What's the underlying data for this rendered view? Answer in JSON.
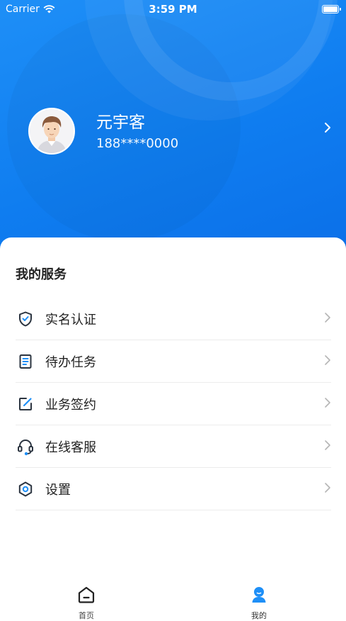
{
  "status_bar": {
    "carrier": "Carrier",
    "time": "3:59 PM"
  },
  "profile": {
    "name": "元宇客",
    "phone": "188****0000"
  },
  "services": {
    "title": "我的服务",
    "items": [
      {
        "label": "实名认证",
        "icon": "shield-check-icon"
      },
      {
        "label": "待办任务",
        "icon": "task-list-icon"
      },
      {
        "label": "业务签约",
        "icon": "edit-sign-icon"
      },
      {
        "label": "在线客服",
        "icon": "headset-icon"
      },
      {
        "label": "设置",
        "icon": "settings-hexagon-icon"
      }
    ]
  },
  "tabbar": {
    "items": [
      {
        "label": "首页",
        "icon": "home-icon",
        "active": false
      },
      {
        "label": "我的",
        "icon": "user-icon",
        "active": true
      }
    ]
  },
  "colors": {
    "primary": "#1e8ff7",
    "icon_dark": "#2b3440",
    "text": "#222222"
  }
}
